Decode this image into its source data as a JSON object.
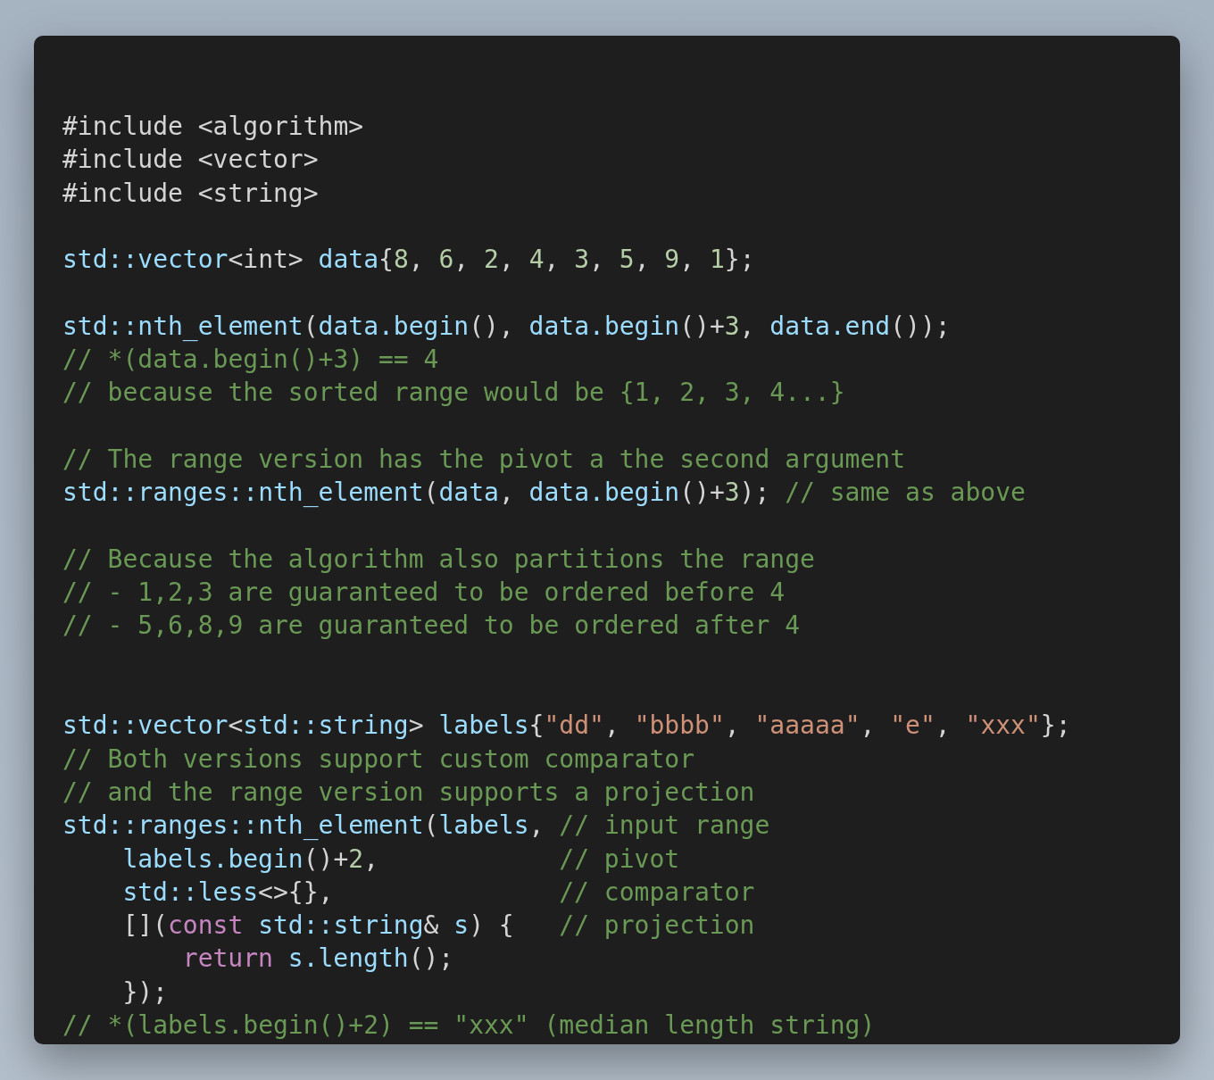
{
  "code_lines": [
    {
      "kind": "code",
      "tokens": [
        {
          "kind": "plain",
          "text": "#include <algorithm>"
        }
      ]
    },
    {
      "kind": "code",
      "tokens": [
        {
          "kind": "plain",
          "text": "#include <vector>"
        }
      ]
    },
    {
      "kind": "code",
      "tokens": [
        {
          "kind": "plain",
          "text": "#include <string>"
        }
      ]
    },
    {
      "kind": "blank"
    },
    {
      "kind": "code",
      "tokens": [
        {
          "kind": "ident",
          "text": "std::vector"
        },
        {
          "kind": "plain",
          "text": "<int> "
        },
        {
          "kind": "ident",
          "text": "data"
        },
        {
          "kind": "plain",
          "text": "{"
        },
        {
          "kind": "number",
          "text": "8"
        },
        {
          "kind": "plain",
          "text": ", "
        },
        {
          "kind": "number",
          "text": "6"
        },
        {
          "kind": "plain",
          "text": ", "
        },
        {
          "kind": "number",
          "text": "2"
        },
        {
          "kind": "plain",
          "text": ", "
        },
        {
          "kind": "number",
          "text": "4"
        },
        {
          "kind": "plain",
          "text": ", "
        },
        {
          "kind": "number",
          "text": "3"
        },
        {
          "kind": "plain",
          "text": ", "
        },
        {
          "kind": "number",
          "text": "5"
        },
        {
          "kind": "plain",
          "text": ", "
        },
        {
          "kind": "number",
          "text": "9"
        },
        {
          "kind": "plain",
          "text": ", "
        },
        {
          "kind": "number",
          "text": "1"
        },
        {
          "kind": "plain",
          "text": "};"
        }
      ]
    },
    {
      "kind": "blank"
    },
    {
      "kind": "code",
      "tokens": [
        {
          "kind": "ident",
          "text": "std::nth_element"
        },
        {
          "kind": "plain",
          "text": "("
        },
        {
          "kind": "ident",
          "text": "data.begin"
        },
        {
          "kind": "plain",
          "text": "(), "
        },
        {
          "kind": "ident",
          "text": "data.begin"
        },
        {
          "kind": "plain",
          "text": "()+"
        },
        {
          "kind": "number",
          "text": "3"
        },
        {
          "kind": "plain",
          "text": ", "
        },
        {
          "kind": "ident",
          "text": "data.end"
        },
        {
          "kind": "plain",
          "text": "());"
        }
      ]
    },
    {
      "kind": "code",
      "tokens": [
        {
          "kind": "comment",
          "text": "// *(data.begin()+3) == 4"
        }
      ]
    },
    {
      "kind": "code",
      "tokens": [
        {
          "kind": "comment",
          "text": "// because the sorted range would be {1, 2, 3, 4...}"
        }
      ]
    },
    {
      "kind": "blank"
    },
    {
      "kind": "code",
      "tokens": [
        {
          "kind": "comment",
          "text": "// The range version has the pivot a the second argument"
        }
      ]
    },
    {
      "kind": "code",
      "tokens": [
        {
          "kind": "ident",
          "text": "std::ranges::nth_element"
        },
        {
          "kind": "plain",
          "text": "("
        },
        {
          "kind": "ident",
          "text": "data"
        },
        {
          "kind": "plain",
          "text": ", "
        },
        {
          "kind": "ident",
          "text": "data.begin"
        },
        {
          "kind": "plain",
          "text": "()+"
        },
        {
          "kind": "number",
          "text": "3"
        },
        {
          "kind": "plain",
          "text": "); "
        },
        {
          "kind": "comment",
          "text": "// same as above"
        }
      ]
    },
    {
      "kind": "blank"
    },
    {
      "kind": "code",
      "tokens": [
        {
          "kind": "comment",
          "text": "// Because the algorithm also partitions the range"
        }
      ]
    },
    {
      "kind": "code",
      "tokens": [
        {
          "kind": "comment",
          "text": "// - 1,2,3 are guaranteed to be ordered before 4"
        }
      ]
    },
    {
      "kind": "code",
      "tokens": [
        {
          "kind": "comment",
          "text": "// - 5,6,8,9 are guaranteed to be ordered after 4"
        }
      ]
    },
    {
      "kind": "blank"
    },
    {
      "kind": "blank"
    },
    {
      "kind": "code",
      "tokens": [
        {
          "kind": "ident",
          "text": "std::vector"
        },
        {
          "kind": "plain",
          "text": "<"
        },
        {
          "kind": "ident",
          "text": "std::string"
        },
        {
          "kind": "plain",
          "text": "> "
        },
        {
          "kind": "ident",
          "text": "labels"
        },
        {
          "kind": "plain",
          "text": "{"
        },
        {
          "kind": "string",
          "text": "\"dd\""
        },
        {
          "kind": "plain",
          "text": ", "
        },
        {
          "kind": "string",
          "text": "\"bbbb\""
        },
        {
          "kind": "plain",
          "text": ", "
        },
        {
          "kind": "string",
          "text": "\"aaaaa\""
        },
        {
          "kind": "plain",
          "text": ", "
        },
        {
          "kind": "string",
          "text": "\"e\""
        },
        {
          "kind": "plain",
          "text": ", "
        },
        {
          "kind": "string",
          "text": "\"xxx\""
        },
        {
          "kind": "plain",
          "text": "};"
        }
      ]
    },
    {
      "kind": "code",
      "tokens": [
        {
          "kind": "comment",
          "text": "// Both versions support custom comparator"
        }
      ]
    },
    {
      "kind": "code",
      "tokens": [
        {
          "kind": "comment",
          "text": "// and the range version supports a projection"
        }
      ]
    },
    {
      "kind": "code",
      "tokens": [
        {
          "kind": "ident",
          "text": "std::ranges::nth_element"
        },
        {
          "kind": "plain",
          "text": "("
        },
        {
          "kind": "ident",
          "text": "labels"
        },
        {
          "kind": "plain",
          "text": ", "
        },
        {
          "kind": "comment",
          "text": "// input range"
        }
      ],
      "children": [
        {
          "kind": "code",
          "tokens": [
            {
              "kind": "ident",
              "text": "labels.begin"
            },
            {
              "kind": "plain",
              "text": "()+"
            },
            {
              "kind": "number",
              "text": "2"
            },
            {
              "kind": "plain",
              "text": ",            "
            },
            {
              "kind": "comment",
              "text": "// pivot"
            }
          ]
        },
        {
          "kind": "code",
          "tokens": [
            {
              "kind": "ident",
              "text": "std::less"
            },
            {
              "kind": "plain",
              "text": "<>{},               "
            },
            {
              "kind": "comment",
              "text": "// comparator"
            }
          ]
        },
        {
          "kind": "code",
          "tokens": [
            {
              "kind": "plain",
              "text": "[]("
            },
            {
              "kind": "keyword",
              "text": "const "
            },
            {
              "kind": "ident",
              "text": "std::string"
            },
            {
              "kind": "plain",
              "text": "& "
            },
            {
              "kind": "ident",
              "text": "s"
            },
            {
              "kind": "plain",
              "text": ") {   "
            },
            {
              "kind": "comment",
              "text": "// projection"
            }
          ],
          "children": [
            {
              "kind": "code",
              "tokens": [
                {
                  "kind": "keyword",
                  "text": "return "
                },
                {
                  "kind": "ident",
                  "text": "s.length"
                },
                {
                  "kind": "plain",
                  "text": "();"
                }
              ]
            }
          ]
        },
        {
          "kind": "code",
          "tokens": [
            {
              "kind": "plain",
              "text": "});"
            }
          ]
        }
      ]
    },
    {
      "kind": "code",
      "tokens": [
        {
          "kind": "comment",
          "text": "// *(labels.begin()+2) == \"xxx\" (median length string)"
        }
      ]
    }
  ]
}
